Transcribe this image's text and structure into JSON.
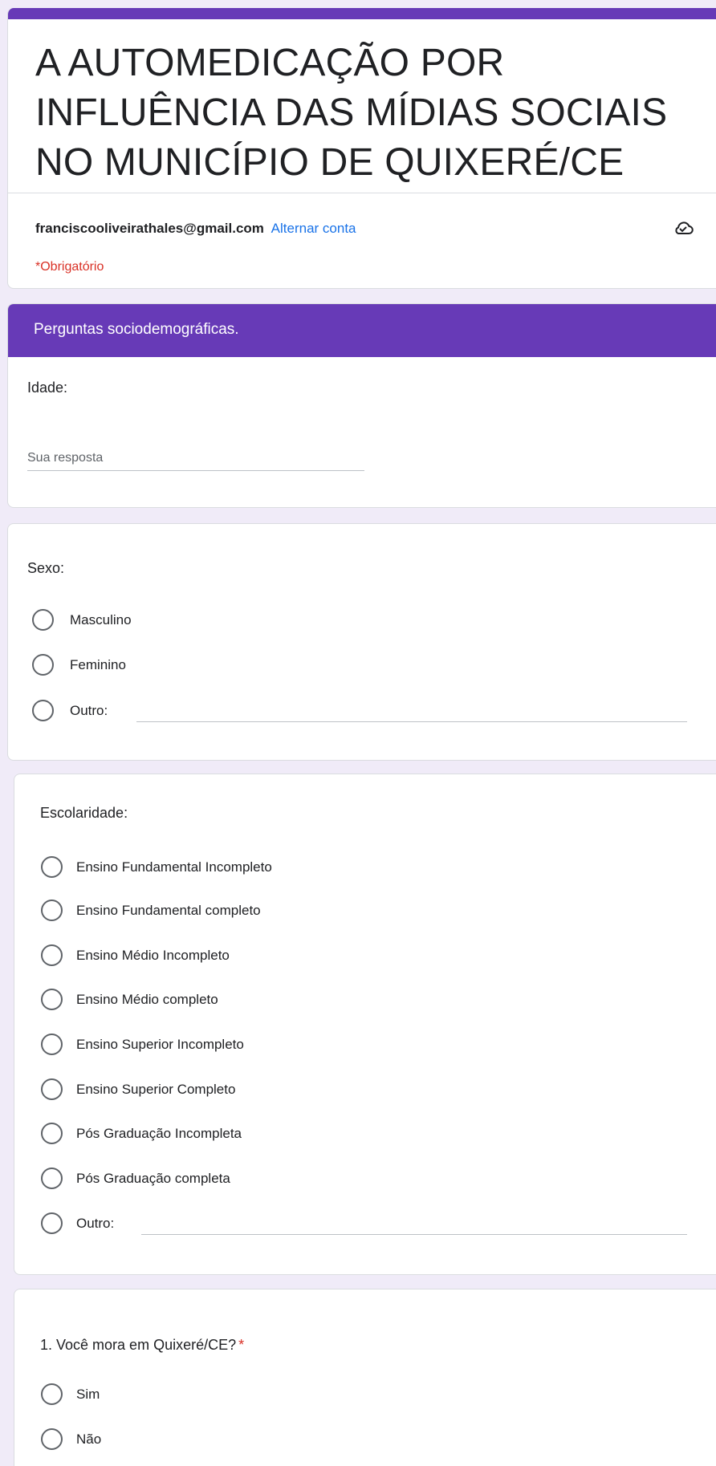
{
  "form": {
    "title": "A AUTOMEDICAÇÃO POR INFLUÊNCIA DAS MÍDIAS SOCIAIS NO MUNICÍPIO DE QUIXERÉ/CE",
    "account_email": "franciscooliveirathales@gmail.com",
    "switch_account": "Alternar conta",
    "required_note": "*Obrigatório"
  },
  "section": {
    "title": "Perguntas sociodemográficas."
  },
  "questions": {
    "idade": {
      "label": "Idade:",
      "placeholder": "Sua resposta"
    },
    "sexo": {
      "label": "Sexo:",
      "options": [
        "Masculino",
        "Feminino",
        "Outro:"
      ]
    },
    "escolaridade": {
      "label": "Escolaridade:",
      "options": [
        "Ensino Fundamental Incompleto",
        "Ensino Fundamental completo",
        "Ensino Médio Incompleto",
        "Ensino Médio completo",
        "Ensino Superior Incompleto",
        "Ensino Superior Completo",
        "Pós Graduação Incompleta",
        "Pós Graduação completa",
        "Outro:"
      ]
    },
    "q1": {
      "label": "1. Você mora em Quixeré/CE?",
      "required_mark": "*",
      "options": [
        "Sim",
        "Não"
      ]
    }
  },
  "colors": {
    "accent": "#673ab7",
    "link": "#1a73e8",
    "required": "#d93025"
  },
  "icons": {
    "cloud": "cloud-check-icon"
  }
}
